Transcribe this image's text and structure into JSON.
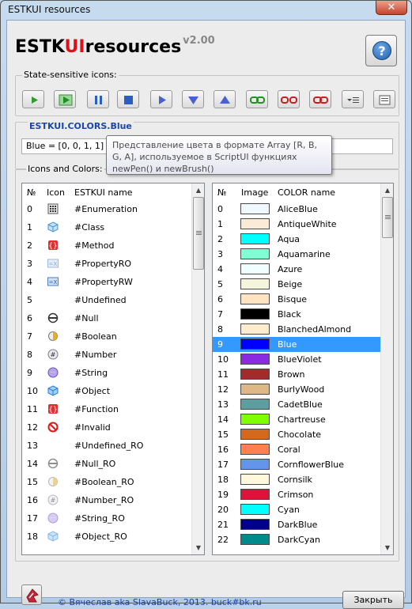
{
  "window": {
    "title": "ESTKUI resources",
    "close_glyph": "✕"
  },
  "app": {
    "title_part1": "ESTK",
    "title_part2": "UI",
    "title_part3": "resources",
    "version": "v2.00",
    "help_glyph": "?"
  },
  "state_icons": {
    "label": "State-sensitive icons:",
    "buttons": [
      "play-icon",
      "play-green-icon",
      "pause-icon",
      "stop-icon",
      "play-right-icon",
      "arrow-down-icon",
      "arrow-up-icon",
      "link-icon",
      "unlink-icon",
      "link-red-icon",
      "menu-list-icon",
      "text-list-icon"
    ]
  },
  "color_detail": {
    "name": "ESTKUI.COLORS.Blue",
    "value": "Blue = [0, 0, 1, 1]",
    "tooltip": "Представление цвета в формате Array [R, B, G, A], используемое в ScriptUI функциях newPen() и newBrush()"
  },
  "icons_colors_label": "Icons and Colors:",
  "icons_table": {
    "headers": [
      "№",
      "Icon",
      "ESTKUI name"
    ],
    "rows": [
      {
        "n": "0",
        "icon": "enumeration-icon",
        "name": "#Enumeration"
      },
      {
        "n": "1",
        "icon": "class-icon",
        "name": "#Class"
      },
      {
        "n": "2",
        "icon": "method-icon",
        "name": "#Method"
      },
      {
        "n": "3",
        "icon": "property-ro-icon",
        "name": "#PropertyRO"
      },
      {
        "n": "4",
        "icon": "property-rw-icon",
        "name": "#PropertyRW"
      },
      {
        "n": "5",
        "icon": "",
        "name": "#Undefined"
      },
      {
        "n": "6",
        "icon": "null-icon",
        "name": "#Null"
      },
      {
        "n": "7",
        "icon": "boolean-icon",
        "name": "#Boolean"
      },
      {
        "n": "8",
        "icon": "number-icon",
        "name": "#Number"
      },
      {
        "n": "9",
        "icon": "string-icon",
        "name": "#String"
      },
      {
        "n": "10",
        "icon": "object-icon",
        "name": "#Object"
      },
      {
        "n": "11",
        "icon": "function-icon",
        "name": "#Function"
      },
      {
        "n": "12",
        "icon": "invalid-icon",
        "name": "#Invalid"
      },
      {
        "n": "13",
        "icon": "",
        "name": "#Undefined_RO"
      },
      {
        "n": "14",
        "icon": "null-ro-icon",
        "name": "#Null_RO"
      },
      {
        "n": "15",
        "icon": "boolean-ro-icon",
        "name": "#Boolean_RO"
      },
      {
        "n": "16",
        "icon": "number-ro-icon",
        "name": "#Number_RO"
      },
      {
        "n": "17",
        "icon": "string-ro-icon",
        "name": "#String_RO"
      },
      {
        "n": "18",
        "icon": "object-ro-icon",
        "name": "#Object_RO"
      }
    ]
  },
  "colors_table": {
    "headers": [
      "№",
      "Image",
      "COLOR name"
    ],
    "selected_index": 9,
    "rows": [
      {
        "n": "0",
        "color": "#F0F8FF",
        "name": "AliceBlue"
      },
      {
        "n": "1",
        "color": "#FAEBD7",
        "name": "AntiqueWhite"
      },
      {
        "n": "2",
        "color": "#00FFFF",
        "name": "Aqua"
      },
      {
        "n": "3",
        "color": "#7FFFD4",
        "name": "Aquamarine"
      },
      {
        "n": "4",
        "color": "#F0FFFF",
        "name": "Azure"
      },
      {
        "n": "5",
        "color": "#F5F5DC",
        "name": "Beige"
      },
      {
        "n": "6",
        "color": "#FFE4C4",
        "name": "Bisque"
      },
      {
        "n": "7",
        "color": "#000000",
        "name": "Black"
      },
      {
        "n": "8",
        "color": "#FFEBCD",
        "name": "BlanchedAlmond"
      },
      {
        "n": "9",
        "color": "#0000FF",
        "name": "Blue"
      },
      {
        "n": "10",
        "color": "#8A2BE2",
        "name": "BlueViolet"
      },
      {
        "n": "11",
        "color": "#A52A2A",
        "name": "Brown"
      },
      {
        "n": "12",
        "color": "#DEB887",
        "name": "BurlyWood"
      },
      {
        "n": "13",
        "color": "#5F9EA0",
        "name": "CadetBlue"
      },
      {
        "n": "14",
        "color": "#7FFF00",
        "name": "Chartreuse"
      },
      {
        "n": "15",
        "color": "#D2691E",
        "name": "Chocolate"
      },
      {
        "n": "16",
        "color": "#FF7F50",
        "name": "Coral"
      },
      {
        "n": "17",
        "color": "#6495ED",
        "name": "CornflowerBlue"
      },
      {
        "n": "18",
        "color": "#FFF8DC",
        "name": "Cornsilk"
      },
      {
        "n": "19",
        "color": "#DC143C",
        "name": "Crimson"
      },
      {
        "n": "20",
        "color": "#00FFFF",
        "name": "Cyan"
      },
      {
        "n": "21",
        "color": "#00008B",
        "name": "DarkBlue"
      },
      {
        "n": "22",
        "color": "#008B8B",
        "name": "DarkCyan"
      }
    ]
  },
  "footer": {
    "credit": "© Вячеслав aka SlavaBuck, 2013. buck#bk.ru",
    "close_label": "Закрыть",
    "logo": "slavabuck-logo-icon"
  },
  "colors": {
    "accent": "#1A47A8",
    "selection": "#3399FF",
    "ui_red": "#E0101A"
  }
}
